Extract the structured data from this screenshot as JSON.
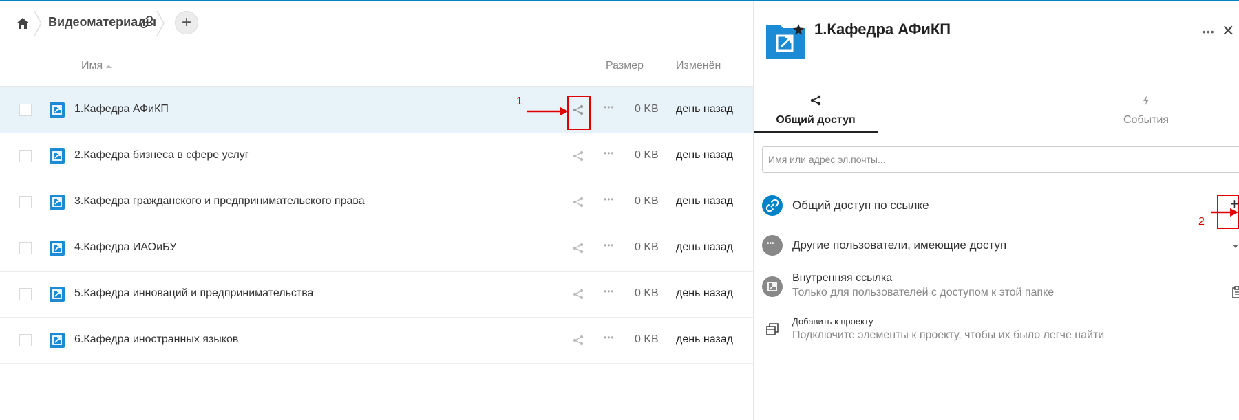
{
  "breadcrumb": {
    "folder": "Видеоматериалы"
  },
  "list_header": {
    "name": "Имя",
    "size": "Размер",
    "modified": "Изменён"
  },
  "rows": [
    {
      "name": "1.Кафедра АФиКП",
      "size": "0 KB",
      "modified": "день назад"
    },
    {
      "name": "2.Кафедра бизнеса в сфере услуг",
      "size": "0 KB",
      "modified": "день назад"
    },
    {
      "name": "3.Кафедра гражданского и предпринимательского права",
      "size": "0 KB",
      "modified": "день назад"
    },
    {
      "name": "4.Кафедра ИАОиБУ",
      "size": "0 KB",
      "modified": "день назад"
    },
    {
      "name": "5.Кафедра инноваций и предпринимательства",
      "size": "0 KB",
      "modified": "день назад"
    },
    {
      "name": "6.Кафедра иностранных языков",
      "size": "0 KB",
      "modified": "день назад"
    }
  ],
  "annotations": {
    "one": "1",
    "two": "2"
  },
  "sidebar": {
    "title": "1.Кафедра АФиКП",
    "tabs": [
      {
        "label": "Общий доступ",
        "icon": "share-icon"
      },
      {
        "label": "События",
        "icon": "activity-icon"
      }
    ],
    "share_placeholder": "Имя или адрес эл.почты...",
    "link_share_label": "Общий доступ по ссылке",
    "other_users_label": "Другие пользователи, имеющие доступ",
    "internal_link_label": "Внутренняя ссылка",
    "internal_link_sub": "Только для пользователей с доступом к этой папке",
    "project_label": "Добавить к проекту",
    "project_sub": "Подключите элементы к проекту, чтобы их было легче найти"
  },
  "colors": {
    "accent": "#0082c9",
    "annotation": "#e00000",
    "selected_row": "#e8f2f9"
  }
}
